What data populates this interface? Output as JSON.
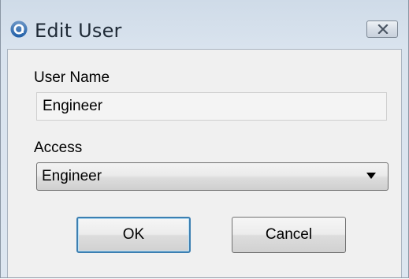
{
  "window": {
    "title": "Edit User",
    "app_icon": "app-logo-icon",
    "close_icon": "close-icon"
  },
  "form": {
    "username_label": "User Name",
    "username_value": "Engineer",
    "access_label": "Access",
    "access_selected": "Engineer",
    "dropdown_icon": "chevron-down-icon"
  },
  "buttons": {
    "ok_label": "OK",
    "cancel_label": "Cancel"
  },
  "colors": {
    "frame": "#d9e3ee",
    "client": "#f0f0f0",
    "focus_border": "#3c7fb1",
    "app_icon": "#1f5fa8"
  }
}
